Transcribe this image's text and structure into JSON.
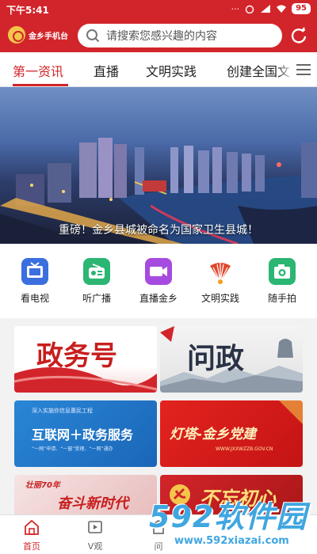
{
  "status": {
    "time": "下午5:41",
    "battery": "95"
  },
  "header": {
    "logo_text": "金乡手机台",
    "search_placeholder": "请搜索您感兴趣的内容"
  },
  "tabs": [
    {
      "label": "第一资讯",
      "active": true
    },
    {
      "label": "直播",
      "active": false
    },
    {
      "label": "文明实践",
      "active": false
    },
    {
      "label": "创建全国文",
      "active": false
    }
  ],
  "banner": {
    "caption": "重磅！金乡县城被命名为国家卫生县城！"
  },
  "quick_items": [
    {
      "label": "看电视",
      "icon": "tv-icon",
      "color": "#3b6fe0"
    },
    {
      "label": "听广播",
      "icon": "radio-icon",
      "color": "#2bb673"
    },
    {
      "label": "直播金乡",
      "icon": "video-camera-icon",
      "color": "#a64be0"
    },
    {
      "label": "文明实践",
      "icon": "civilization-fan-icon",
      "color": "#e0462b"
    },
    {
      "label": "随手拍",
      "icon": "camera-icon",
      "color": "#2bb673"
    }
  ],
  "cards": {
    "zhengwu": {
      "title": "政务号"
    },
    "wenzheng": {
      "title": "问政"
    },
    "hulianwang": {
      "title": "互联网＋政务服务",
      "subtitle": "深入实施你信息惠民工程",
      "tagline": "“一网”申请、“一窗”受理、“一网”通办"
    },
    "dengta": {
      "title": "灯塔-金乡党建",
      "url": "WWW.JXXWZZB.GOV.CN"
    },
    "fendou": {
      "title": "奋斗新时代",
      "prefix": "壮丽70年"
    },
    "buwang": {
      "title": "不忘初心"
    }
  },
  "bottom_nav": [
    {
      "label": "首页",
      "icon": "home-icon",
      "active": true
    },
    {
      "label": "V观",
      "icon": "video-icon",
      "active": false
    },
    {
      "label": "问",
      "icon": "building-icon",
      "active": false
    }
  ],
  "watermark": {
    "brand": "592软件园",
    "url": "www.592xiazai.com"
  }
}
